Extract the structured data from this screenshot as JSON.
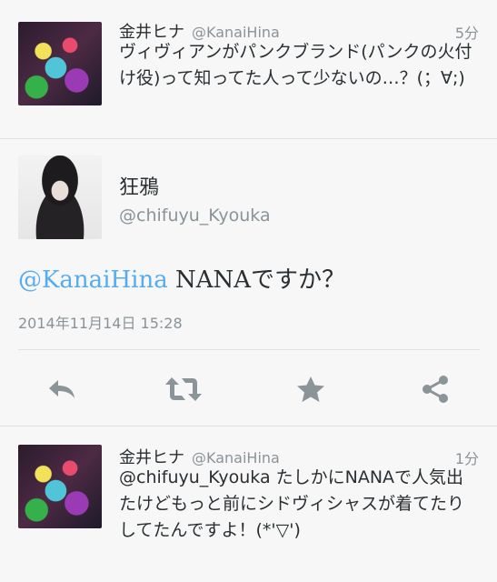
{
  "tweets": [
    {
      "name": "金井ヒナ",
      "handle": "@KanaiHina",
      "time": "5分",
      "text": "ヴィヴィアンがパンクブランド(パンクの火付け役)って知ってた人って少ないの…？(；∀;)"
    },
    {
      "name": "金井ヒナ",
      "handle": "@KanaiHina",
      "time": "1分",
      "text": "@chifuyu_Kyouka たしかにNANAで人気出たけどもっと前にシドヴィシャスが着てたりしてたんですよ！(*'▽')"
    }
  ],
  "detail": {
    "name": "狂鴉",
    "handle": "@chifuyu_Kyouka",
    "mention": "@KanaiHina",
    "text": " NANAですか？",
    "timestamp": "2014年11月14日 15:28"
  },
  "actions": [
    {
      "icon": "reply-icon"
    },
    {
      "icon": "retweet-icon"
    },
    {
      "icon": "favorite-star-icon"
    },
    {
      "icon": "share-icon"
    }
  ],
  "colors": {
    "link": "#55acee",
    "icon": "#8a9499",
    "muted": "#8b9399"
  }
}
